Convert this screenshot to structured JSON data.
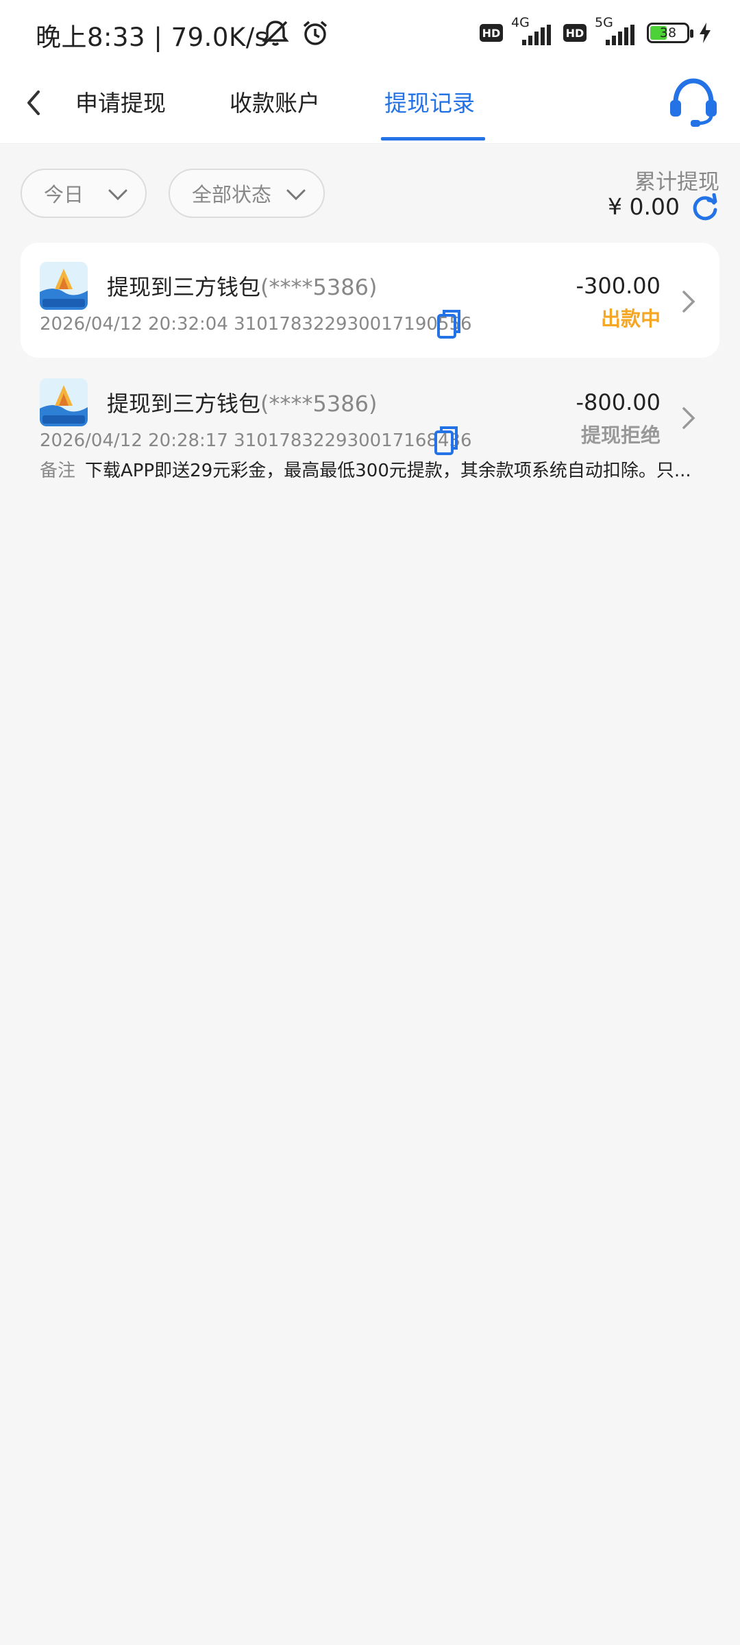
{
  "status_bar": {
    "time": "晚上8:33 | 79.0K/s",
    "hd1": "HD",
    "net1": "4G",
    "hd2": "HD",
    "net2": "5G",
    "battery": "38"
  },
  "tabs": [
    {
      "label": "申请提现"
    },
    {
      "label": "收款账户"
    },
    {
      "label": "提现记录"
    }
  ],
  "filters": {
    "date": "今日",
    "status": "全部状态"
  },
  "summary": {
    "label": "累计提现",
    "amount": "¥ 0.00"
  },
  "records": [
    {
      "title": "提现到三方钱包",
      "account": "(****5386)",
      "meta": "2026/04/12 20:32:04 310178322930017190556",
      "amount": "-300.00",
      "status": "出款中",
      "status_color": "#f5a623"
    },
    {
      "title": "提现到三方钱包",
      "account": "(****5386)",
      "meta": "2026/04/12 20:28:17 310178322930017168436",
      "amount": "-800.00",
      "status": "提现拒绝",
      "status_color": "#999999",
      "remark_label": "备注",
      "remark": "下载APP即送29元彩金，最高最低300元提款，其余款项系统自动扣除。只..."
    }
  ],
  "colors": {
    "accent": "#2473e6",
    "pending": "#f5a623",
    "rejected": "#999999"
  }
}
